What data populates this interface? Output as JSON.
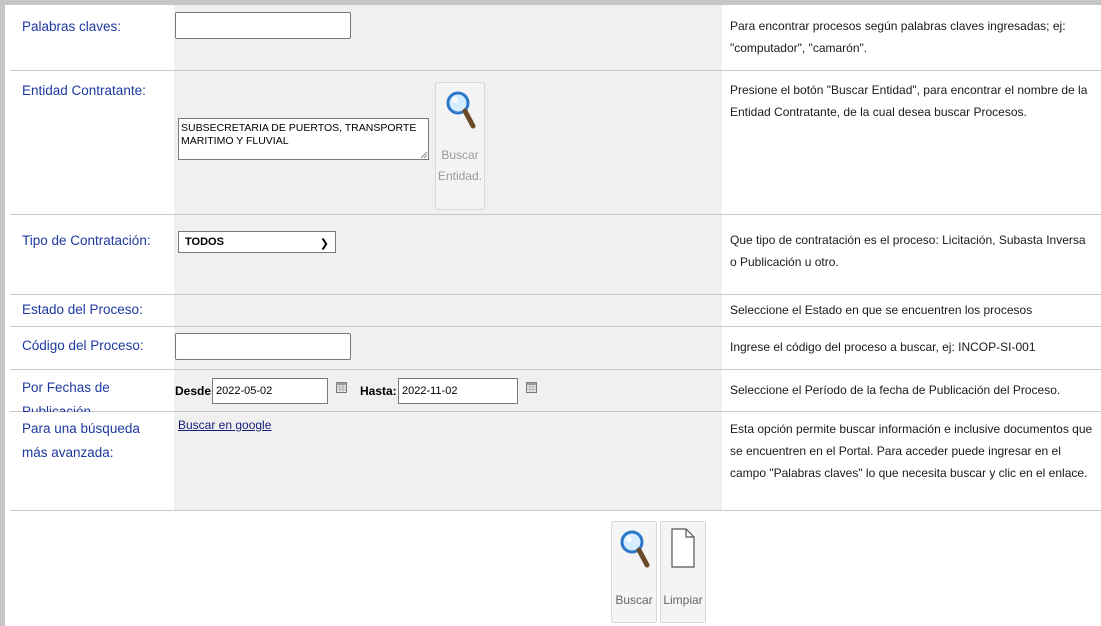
{
  "rows": {
    "palabras": {
      "label": "Palabras claves:",
      "value": "",
      "help": "Para encontrar procesos según palabras claves ingresadas; ej: \"computador\", \"camarón\"."
    },
    "entidad": {
      "label": "Entidad Contratante:",
      "value": "SUBSECRETARIA DE PUERTOS, TRANSPORTE MARITIMO Y FLUVIAL",
      "button_line1": "Buscar",
      "button_line2": "Entidad.",
      "help": "Presione el botón \"Buscar Entidad\", para encontrar el nombre de la Entidad Contratante, de la cual desea buscar Procesos."
    },
    "tipo": {
      "label": "Tipo de Contratación:",
      "selected": "TODOS",
      "help": "Que tipo de contratación es el proceso: Licitación, Subasta Inversa o Publicación u otro."
    },
    "estado": {
      "label": "Estado del Proceso:",
      "help": "Seleccione el Estado en que se encuentren los procesos interesados."
    },
    "codigo": {
      "label": "Código del Proceso:",
      "value": "",
      "help": "Ingrese el código del proceso a buscar, ej: INCOP-SI-001"
    },
    "fechas": {
      "label": "Por Fechas de Publicación",
      "desde_label": "Desde:",
      "desde_value": "2022-05-02",
      "hasta_label": "Hasta:",
      "hasta_value": "2022-11-02",
      "help": "Seleccione el Período de la fecha de Publicación del Proceso."
    },
    "avanzada": {
      "label": "Para una búsqueda más avanzada:",
      "link": "Buscar en google",
      "help": "Esta opción permite buscar información e inclusive documentos que se encuentren en el Portal. Para acceder puede ingresar en el campo \"Palabras claves\" lo que necesita buscar y clic en el enlace."
    }
  },
  "actions": {
    "search_label": "Buscar",
    "clear_label": "Limpiar"
  },
  "icons": {
    "search": "magnifier-icon",
    "clear": "blank-document-icon",
    "calendar": "calendar-icon"
  },
  "colors": {
    "label_text": "#1c39a0",
    "control_bg": "#f0f0f0",
    "link": "#141e78"
  }
}
